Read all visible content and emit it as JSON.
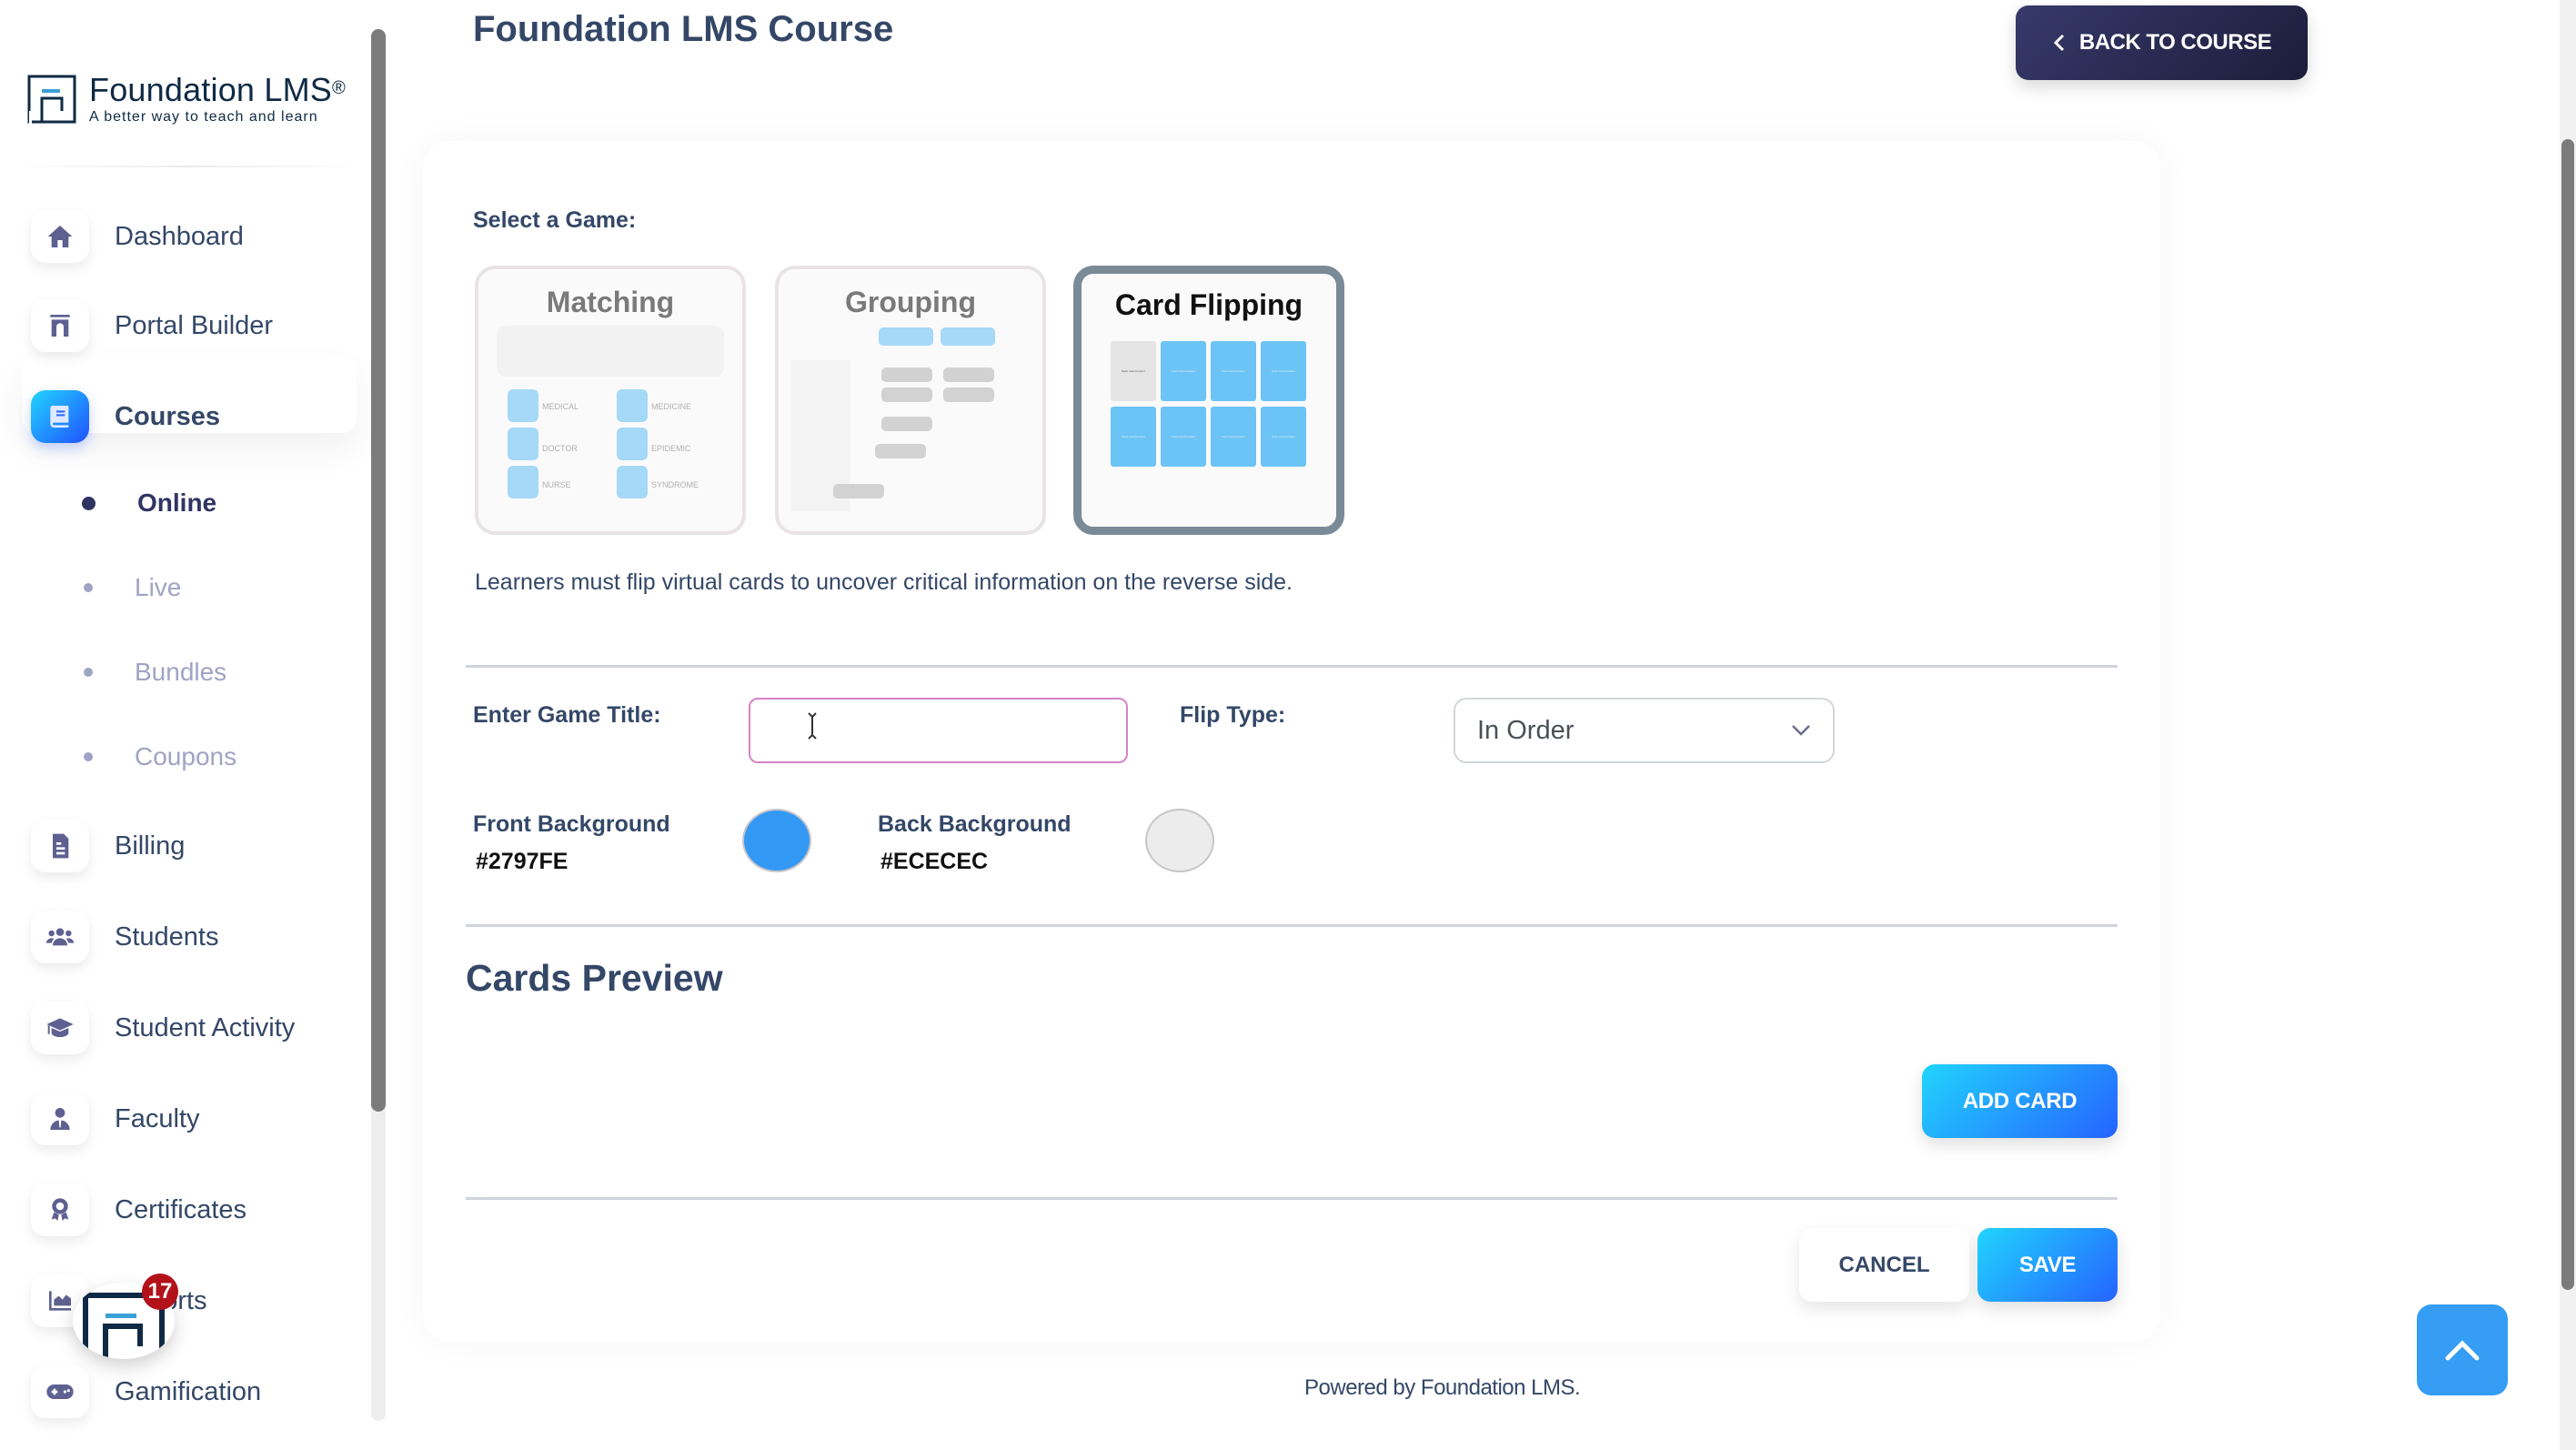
{
  "brand": {
    "name": "Foundation LMS",
    "registered": "®",
    "tagline": "A better way to teach and learn"
  },
  "sidebar": {
    "items": [
      {
        "label": "Dashboard",
        "icon": "home-icon"
      },
      {
        "label": "Portal Builder",
        "icon": "portal-icon"
      },
      {
        "label": "Courses",
        "icon": "book-icon",
        "active": true
      },
      {
        "label": "Billing",
        "icon": "invoice-icon"
      },
      {
        "label": "Students",
        "icon": "users-icon"
      },
      {
        "label": "Student Activity",
        "icon": "graduation-cap-icon"
      },
      {
        "label": "Faculty",
        "icon": "faculty-icon"
      },
      {
        "label": "Certificates",
        "icon": "award-icon"
      },
      {
        "label": "Reports",
        "icon": "chart-area-icon"
      },
      {
        "label": "Gamification",
        "icon": "gamepad-icon"
      }
    ],
    "courses_sub": [
      {
        "label": "Online",
        "active": true
      },
      {
        "label": "Live"
      },
      {
        "label": "Bundles"
      },
      {
        "label": "Coupons"
      }
    ]
  },
  "launcher": {
    "badge_count": "17"
  },
  "header": {
    "title": "Foundation LMS Course",
    "back_button": "BACK TO COURSE"
  },
  "game_select": {
    "label": "Select a Game:",
    "options": [
      {
        "title": "Matching",
        "preview_labels": [
          "MEDICAL",
          "MEDICINE",
          "DOCTOR",
          "EPIDEMIC",
          "NURSE",
          "SYNDROME"
        ]
      },
      {
        "title": "Grouping"
      },
      {
        "title": "Card Flipping",
        "selected": true,
        "preview_back": "Back Card Content",
        "preview_front": "Front Card Content"
      }
    ],
    "description": "Learners must flip virtual cards to uncover critical information on the reverse side."
  },
  "form": {
    "game_title_label": "Enter Game Title:",
    "game_title_value": "",
    "flip_type_label": "Flip Type:",
    "flip_type_value": "In Order",
    "front_bg_label": "Front Background",
    "front_bg_value": "#2797FE",
    "back_bg_label": "Back Background",
    "back_bg_value": "#ECECEC"
  },
  "colors": {
    "front_swatch": "#3399f5",
    "back_swatch": "#ECECEC",
    "accent": "#2152ff",
    "primary_text": "#344767"
  },
  "cards_preview": {
    "heading": "Cards Preview",
    "add_button": "ADD CARD"
  },
  "actions": {
    "cancel": "CANCEL",
    "save": "SAVE"
  },
  "footer": {
    "text": "Powered by Foundation LMS."
  }
}
